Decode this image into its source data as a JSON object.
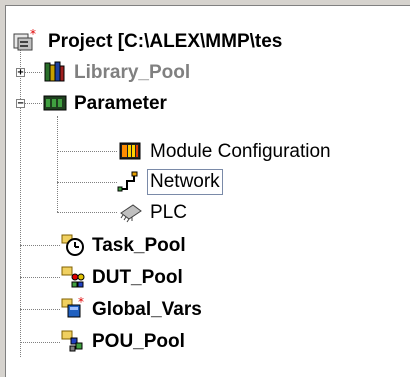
{
  "tree": {
    "root": {
      "label": "Project [C:\\ALEX\\MMP\\tes",
      "icon": "project-modified-icon"
    },
    "items": [
      {
        "label": "Library_Pool",
        "icon": "library-books-icon",
        "expander": "+"
      },
      {
        "label": "Parameter",
        "icon": "parameter-module-icon",
        "expander": "−"
      },
      {
        "label": "Module Configuration",
        "icon": "module-configuration-icon"
      },
      {
        "label": "Network",
        "icon": "network-icon"
      },
      {
        "label": "PLC",
        "icon": "plc-chip-icon"
      },
      {
        "label": "Task_Pool",
        "icon": "task-clock-icon"
      },
      {
        "label": "DUT_Pool",
        "icon": "dut-pool-icon"
      },
      {
        "label": "Global_Vars",
        "icon": "global-vars-icon"
      },
      {
        "label": "POU_Pool",
        "icon": "pou-pool-icon"
      }
    ]
  },
  "colors": {
    "background": "#d6d3ce",
    "tree_background": "#ffffff",
    "disabled_text": "#808080",
    "selection_border": "#7a8aa8"
  }
}
